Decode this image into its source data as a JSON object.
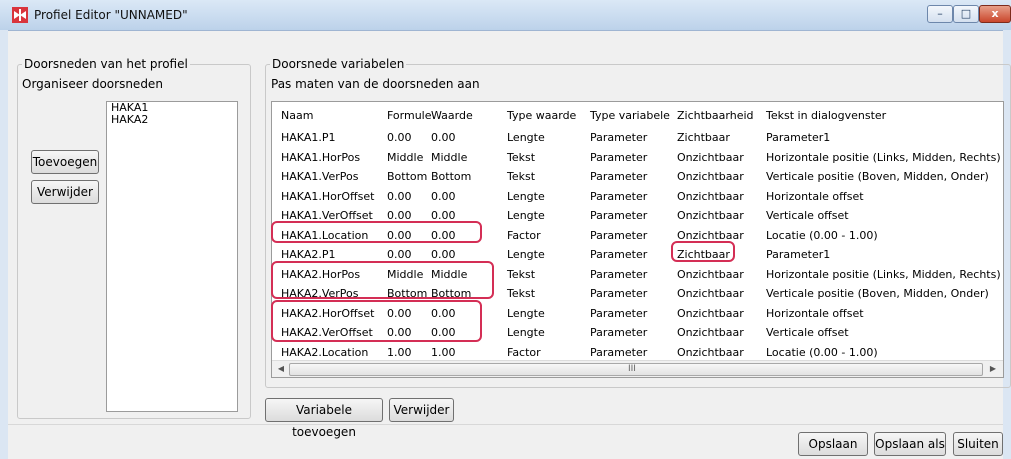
{
  "window": {
    "title": "Profiel Editor \"UNNAMED\"",
    "controls": {
      "minimize": "–",
      "maximize": "□",
      "close": "x"
    }
  },
  "left_panel": {
    "title": "Doorsneden van het profiel",
    "subtitle": "Organiseer doorsneden",
    "list": [
      "HAKA1",
      "HAKA2"
    ],
    "add_button": "Toevoegen",
    "remove_button": "Verwijder"
  },
  "right_panel": {
    "title": "Doorsnede variabelen",
    "subtitle": "Pas maten van de doorsneden aan",
    "columns": [
      "Naam",
      "Formule",
      "Waarde",
      "Type waarde",
      "Type variabele",
      "Zichtbaarheid",
      "Tekst in dialogvenster"
    ],
    "rows": [
      [
        "HAKA1.P1",
        "0.00",
        "0.00",
        "Lengte",
        "Parameter",
        "Zichtbaar",
        "Parameter1"
      ],
      [
        "HAKA1.HorPos",
        "Middle",
        "Middle",
        "Tekst",
        "Parameter",
        "Onzichtbaar",
        "Horizontale positie (Links, Midden, Rechts)"
      ],
      [
        "HAKA1.VerPos",
        "Bottom",
        "Bottom",
        "Tekst",
        "Parameter",
        "Onzichtbaar",
        "Verticale positie (Boven, Midden, Onder)"
      ],
      [
        "HAKA1.HorOffset",
        "0.00",
        "0.00",
        "Lengte",
        "Parameter",
        "Onzichtbaar",
        "Horizontale offset"
      ],
      [
        "HAKA1.VerOffset",
        "0.00",
        "0.00",
        "Lengte",
        "Parameter",
        "Onzichtbaar",
        "Verticale offset"
      ],
      [
        "HAKA1.Location",
        "0.00",
        "0.00",
        "Factor",
        "Parameter",
        "Onzichtbaar",
        "Locatie (0.00 - 1.00)"
      ],
      [
        "HAKA2.P1",
        "0.00",
        "0.00",
        "Lengte",
        "Parameter",
        "Zichtbaar",
        "Parameter1"
      ],
      [
        "HAKA2.HorPos",
        "Middle",
        "Middle",
        "Tekst",
        "Parameter",
        "Onzichtbaar",
        "Horizontale positie (Links, Midden, Rechts)"
      ],
      [
        "HAKA2.VerPos",
        "Bottom",
        "Bottom",
        "Tekst",
        "Parameter",
        "Onzichtbaar",
        "Verticale positie (Boven, Midden, Onder)"
      ],
      [
        "HAKA2.HorOffset",
        "0.00",
        "0.00",
        "Lengte",
        "Parameter",
        "Onzichtbaar",
        "Horizontale offset"
      ],
      [
        "HAKA2.VerOffset",
        "0.00",
        "0.00",
        "Lengte",
        "Parameter",
        "Onzichtbaar",
        "Verticale offset"
      ],
      [
        "HAKA2.Location",
        "1.00",
        "1.00",
        "Factor",
        "Parameter",
        "Onzichtbaar",
        "Locatie (0.00 - 1.00)"
      ]
    ],
    "scroll_grip": "III",
    "add_variable_button": "Variabele toevoegen",
    "remove_variable_button": "Verwijder"
  },
  "footer": {
    "save": "Opslaan",
    "save_as": "Opslaan als",
    "close": "Sluiten"
  },
  "colors": {
    "highlight": "#d42e55",
    "title_bar": "#c9dbef"
  }
}
